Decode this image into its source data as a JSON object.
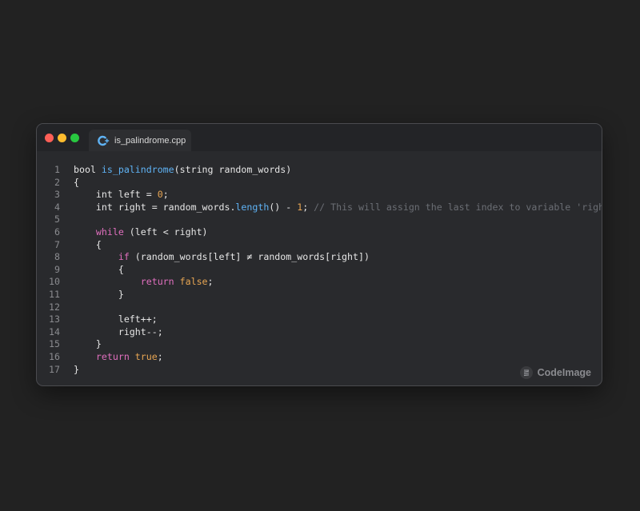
{
  "window": {
    "tab": {
      "label": "is_palindrome.cpp",
      "icon": "cpp-file-icon"
    }
  },
  "code": {
    "language": "cpp",
    "lines": [
      {
        "number": "1",
        "tokens": [
          {
            "t": "bool "
          },
          {
            "t": "is_palindrome",
            "c": "fn"
          },
          {
            "t": "(string random_words)"
          }
        ]
      },
      {
        "number": "2",
        "tokens": [
          {
            "t": "{"
          }
        ]
      },
      {
        "number": "3",
        "tokens": [
          {
            "t": "    int left = "
          },
          {
            "t": "0",
            "c": "num"
          },
          {
            "t": ";"
          }
        ]
      },
      {
        "number": "4",
        "tokens": [
          {
            "t": "    int right = random_words."
          },
          {
            "t": "length",
            "c": "fn"
          },
          {
            "t": "() - "
          },
          {
            "t": "1",
            "c": "num"
          },
          {
            "t": "; "
          },
          {
            "t": "// This will assign the last index to variable 'right'",
            "c": "cm"
          }
        ]
      },
      {
        "number": "5",
        "tokens": []
      },
      {
        "number": "6",
        "tokens": [
          {
            "t": "    "
          },
          {
            "t": "while",
            "c": "kw"
          },
          {
            "t": " (left < right)"
          }
        ]
      },
      {
        "number": "7",
        "tokens": [
          {
            "t": "    {"
          }
        ]
      },
      {
        "number": "8",
        "tokens": [
          {
            "t": "        "
          },
          {
            "t": "if",
            "c": "kw"
          },
          {
            "t": " (random_words[left] ≠ random_words[right])"
          }
        ]
      },
      {
        "number": "9",
        "tokens": [
          {
            "t": "        {"
          }
        ]
      },
      {
        "number": "10",
        "tokens": [
          {
            "t": "            "
          },
          {
            "t": "return",
            "c": "kw"
          },
          {
            "t": " "
          },
          {
            "t": "false",
            "c": "bool"
          },
          {
            "t": ";"
          }
        ]
      },
      {
        "number": "11",
        "tokens": [
          {
            "t": "        }"
          }
        ]
      },
      {
        "number": "12",
        "tokens": []
      },
      {
        "number": "13",
        "tokens": [
          {
            "t": "        left++;"
          }
        ]
      },
      {
        "number": "14",
        "tokens": [
          {
            "t": "        right--;"
          }
        ]
      },
      {
        "number": "15",
        "tokens": [
          {
            "t": "    }"
          }
        ]
      },
      {
        "number": "16",
        "tokens": [
          {
            "t": "    "
          },
          {
            "t": "return",
            "c": "kw"
          },
          {
            "t": " "
          },
          {
            "t": "true",
            "c": "bool"
          },
          {
            "t": ";"
          }
        ]
      },
      {
        "number": "17",
        "tokens": [
          {
            "t": "}"
          }
        ]
      }
    ]
  },
  "brand": {
    "label": "CodeImage",
    "icon": "codeimage-logo-icon"
  },
  "colors": {
    "background": "#222222",
    "window": "#292a2d",
    "function": "#5fb3f5",
    "number": "#e8a653",
    "keyword": "#e06fbe",
    "comment": "#6b6e74"
  }
}
